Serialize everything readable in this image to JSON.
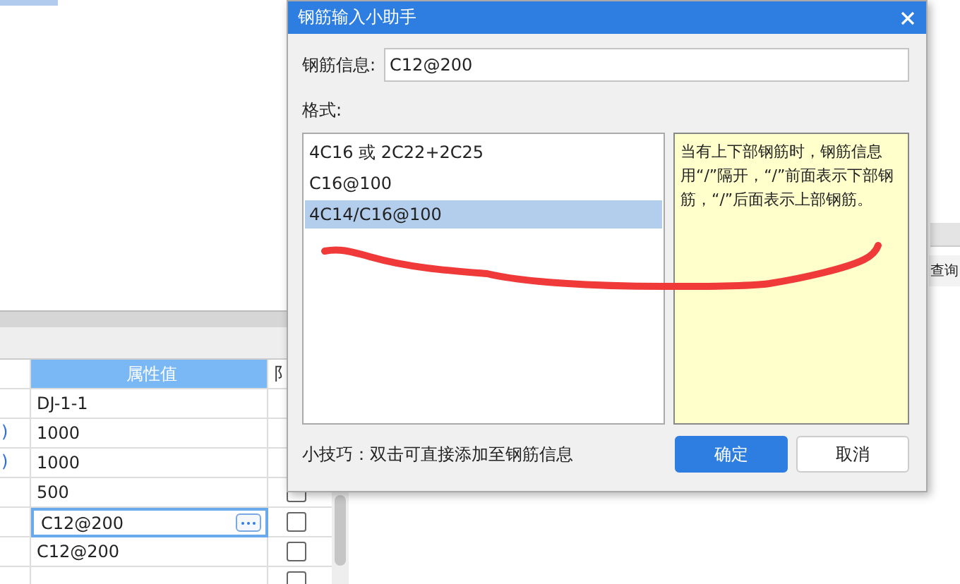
{
  "properties": {
    "columns": [
      "属性值",
      "阝"
    ],
    "rows": [
      {
        "value": "DJ-1-1"
      },
      {
        "marker": ")",
        "value": "1000"
      },
      {
        "marker": ")",
        "value": "1000"
      },
      {
        "value": "500",
        "checked": false
      },
      {
        "value": "C12@200",
        "editing": true,
        "checked": false
      },
      {
        "value": "C12@200",
        "checked": false
      },
      {
        "checked": false
      }
    ]
  },
  "side_button": "查询",
  "dialog": {
    "title": "钢筋输入小助手",
    "info_label": "钢筋信息:",
    "info_value": "C12@200",
    "format_label": "格式:",
    "formats": [
      {
        "label": "4C16 或 2C22+2C25",
        "selected": false
      },
      {
        "label": "C16@100",
        "selected": false
      },
      {
        "label": "4C14/C16@100",
        "selected": true
      }
    ],
    "description": "当有上下部钢筋时，钢筋信息用“/”隔开，“/”前面表示下部钢筋，“/”后面表示上部钢筋。",
    "tip": "小技巧：双击可直接添加至钢筋信息",
    "buttons": [
      {
        "label": "确定",
        "kind": "primary"
      },
      {
        "label": "取消",
        "kind": "secondary"
      }
    ]
  }
}
